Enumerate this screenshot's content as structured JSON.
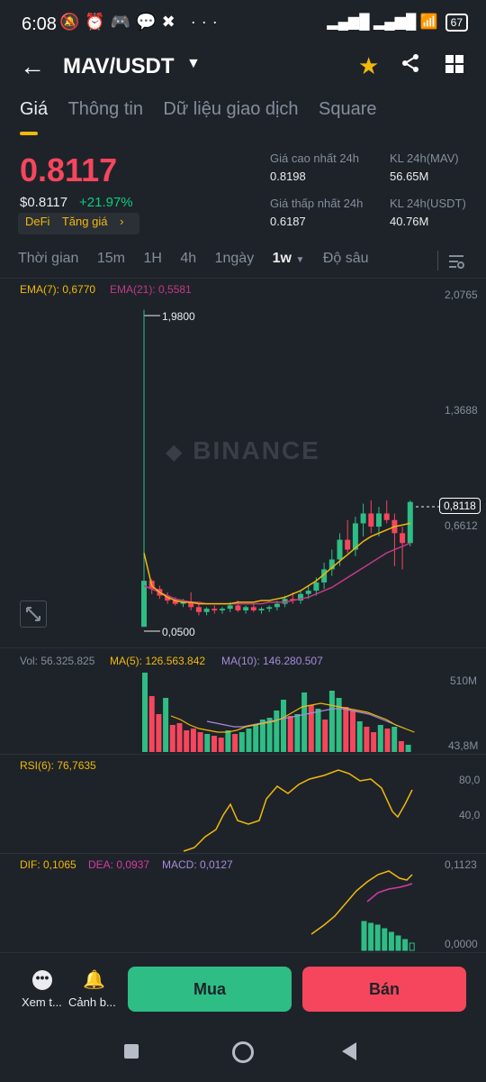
{
  "status_bar": {
    "time": "6:08",
    "battery": "67"
  },
  "header": {
    "pair": "MAV/USDT"
  },
  "tabs": [
    {
      "label": "Giá",
      "active": true
    },
    {
      "label": "Thông tin",
      "active": false
    },
    {
      "label": "Dữ liệu giao dịch",
      "active": false
    },
    {
      "label": "Square",
      "active": false
    }
  ],
  "ticker": {
    "price": "0.8117",
    "fiat_price": "$0.8117",
    "change": "+21.97%",
    "tags": [
      "DeFi",
      "Tăng giá",
      "›"
    ],
    "high_label": "Giá cao nhất 24h",
    "high_value": "0.8198",
    "low_label": "Giá thấp nhất 24h",
    "low_value": "0.6187",
    "vol_mav_label": "KL 24h(MAV)",
    "vol_mav_value": "56.65M",
    "vol_usdt_label": "KL 24h(USDT)",
    "vol_usdt_value": "40.76M"
  },
  "timeframes": {
    "items": [
      "Thời gian",
      "15m",
      "1H",
      "4h",
      "1ngày",
      "1w",
      "Độ sâu"
    ],
    "selected": "1w",
    "selected_caret": "▼"
  },
  "main_chart": {
    "ema7_label": "EMA(7): 0,6770",
    "ema21_label": "EMA(21): 0,5581",
    "axis": [
      "2,0765",
      "1,3688",
      "0,6612"
    ],
    "current_price_tag": "0,8118",
    "high_marker": "1,9800",
    "low_marker": "0,0500",
    "watermark": "BINANCE"
  },
  "volume_panel": {
    "vol_label": "Vol: 56.325.825",
    "ma5_label": "MA(5): 126.563.842",
    "ma10_label": "MA(10): 146.280.507",
    "axis_top": "510M",
    "axis_bottom": "43,8M"
  },
  "rsi_panel": {
    "label": "RSI(6): 76,7635",
    "axis_top": "80,0",
    "axis_bottom": "40,0"
  },
  "macd_panel": {
    "dif_label": "DIF: 0,1065",
    "dea_label": "DEA: 0,0937",
    "macd_label": "MACD: 0,0127",
    "axis_top": "0,1123",
    "axis_bottom": "0,0000"
  },
  "bottom_bar": {
    "more_label": "Xem t...",
    "alert_label": "Cảnh b...",
    "buy_label": "Mua",
    "sell_label": "Bán"
  },
  "colors": {
    "up": "#2ebd85",
    "down": "#f6465d",
    "accent": "#f0b90b",
    "ema21": "#c23a87",
    "macd_dea": "#d63aa6",
    "ma10": "#a78bda"
  },
  "chart_data": {
    "type": "candlestick",
    "series": [
      {
        "name": "EMA(7)",
        "values": [
          0.5,
          0.3,
          0.26,
          0.23,
          0.21,
          0.2,
          0.2,
          0.19,
          0.19,
          0.19,
          0.19,
          0.19,
          0.2,
          0.2,
          0.2,
          0.21,
          0.21,
          0.22,
          0.23,
          0.25,
          0.27,
          0.3,
          0.33,
          0.37,
          0.41,
          0.45,
          0.49,
          0.53,
          0.57,
          0.6,
          0.62,
          0.64,
          0.66,
          0.67,
          0.68
        ]
      },
      {
        "name": "EMA(21)",
        "values": [
          0.3,
          0.28,
          0.26,
          0.24,
          0.22,
          0.21,
          0.2,
          0.2,
          0.19,
          0.19,
          0.19,
          0.19,
          0.19,
          0.19,
          0.19,
          0.19,
          0.2,
          0.2,
          0.2,
          0.21,
          0.22,
          0.23,
          0.25,
          0.27,
          0.29,
          0.32,
          0.35,
          0.38,
          0.41,
          0.44,
          0.47,
          0.5,
          0.52,
          0.54,
          0.56
        ]
      }
    ],
    "y_range": [
      0.05,
      2.0765
    ]
  }
}
